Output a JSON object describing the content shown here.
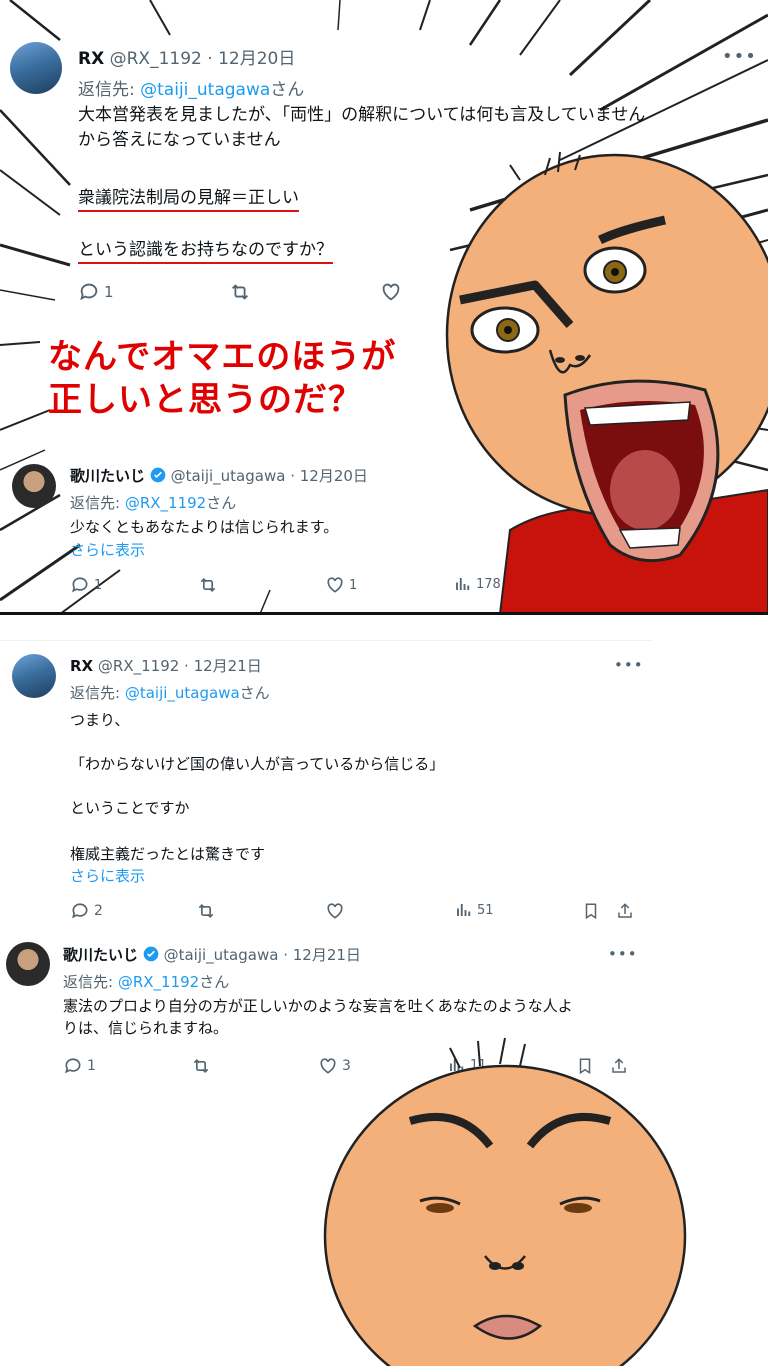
{
  "tweet1": {
    "name": "RX",
    "handle": "@RX_1192",
    "date": "12月20日",
    "reply_prefix": "返信先: ",
    "reply_to": "@taiji_utagawa",
    "reply_suffix": "さん",
    "line1": "大本営発表を見ましたが、「両性」の解釈については何も言及していません",
    "line2": "から答えになっていません",
    "line3": "衆議院法制局の見解＝正しい",
    "line4": "という認識をお持ちなのですか？",
    "reply_count": "1"
  },
  "shout": {
    "line1": "なんでオマエのほうが",
    "line2": "正しいと思うのだ？"
  },
  "tweet2": {
    "name": "歌川たいじ",
    "handle": "@taiji_utagawa",
    "date": "12月20日",
    "reply_prefix": "返信先: ",
    "reply_to": "@RX_1192",
    "reply_suffix": "さん",
    "text": "少なくともあなたよりは信じられます。",
    "show_more": "さらに表示",
    "reply_count": "1",
    "like_count": "1",
    "view_count": "178"
  },
  "tweet3": {
    "name": "RX",
    "handle": "@RX_1192",
    "date": "12月21日",
    "reply_prefix": "返信先: ",
    "reply_to": "@taiji_utagawa",
    "reply_suffix": "さん",
    "line1": "つまり、",
    "line2": "「わからないけど国の偉い人が言っているから信じる」",
    "line3": "ということですか",
    "line4": "権威主義だったとは驚きです",
    "show_more": "さらに表示",
    "reply_count": "2",
    "view_count": "51"
  },
  "tweet4": {
    "name": "歌川たいじ",
    "handle": "@taiji_utagawa",
    "date": "12月21日",
    "reply_prefix": "返信先: ",
    "reply_to": "@RX_1192",
    "reply_suffix": "さん",
    "line1": "憲法のプロより自分の方が正しいかのような妄言を吐くあなたのような人よ",
    "line2": "りは、信じられますね。",
    "reply_count": "1",
    "like_count": "3",
    "view_count": "11"
  },
  "sep": " · ",
  "more_glyph": "•••",
  "colors": {
    "accent": "#1d9bf0",
    "shout": "#e00000",
    "muted": "#536471",
    "shirt": "#c8120c",
    "skin": "#f4b07a"
  }
}
